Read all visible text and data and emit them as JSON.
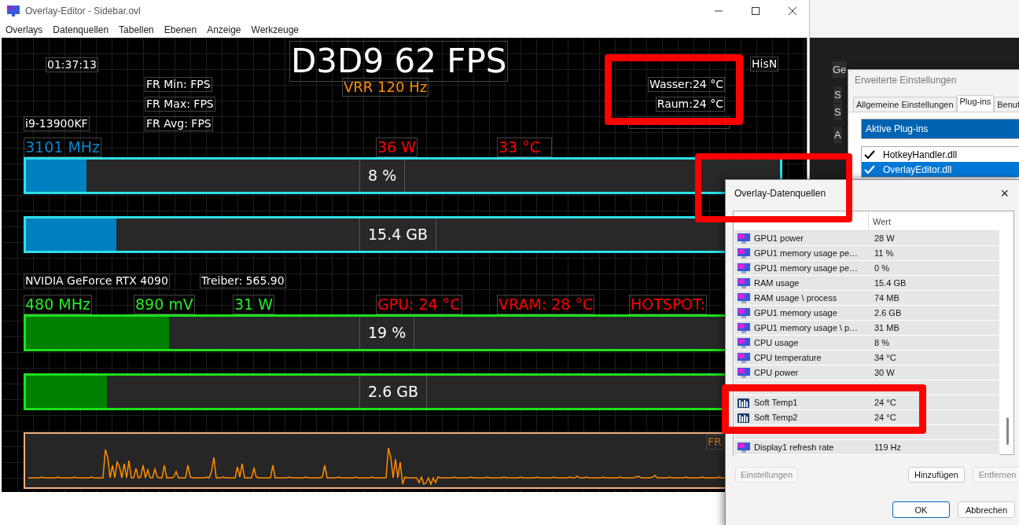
{
  "window": {
    "title": "Overlay-Editor - Sidebar.ovl"
  },
  "menu": [
    "Overlays",
    "Datenquellen",
    "Tabellen",
    "Ebenen",
    "Anzeige",
    "Werkzeuge"
  ],
  "overlay": {
    "clock": "01:37:13",
    "fps": "D3D9 62 FPS",
    "vrr": "VRR 120 Hz",
    "frame_stats": [
      "FR Min:  FPS",
      "FR Max:  FPS",
      "FR Avg:  FPS"
    ],
    "cpu_name": "i9-13900KF",
    "hisn": "HisN",
    "sensors": [
      "Wasser:24 °C",
      "Raum:24 °C"
    ],
    "cpu_readings": [
      {
        "text": "3101 MHz",
        "color": "#0a84c8"
      },
      {
        "text": "36 W",
        "color": "#ff0000"
      },
      {
        "text": "33 °C",
        "color": "#ff0000"
      }
    ],
    "cpu_bars": [
      {
        "level": 0.08,
        "reading": "8 %"
      },
      {
        "level": 0.12,
        "reading": "15.4 GB"
      }
    ],
    "gpu_name": "NVIDIA GeForce RTX 4090",
    "driver": "Treiber: 565.90",
    "gpu_readings": [
      {
        "text": "480 MHz",
        "color": "#22ee22"
      },
      {
        "text": "890 mV",
        "color": "#22ee22"
      },
      {
        "text": "31 W",
        "color": "#22ee22"
      },
      {
        "text": "GPU: 24 °C",
        "color": "#ff0000"
      },
      {
        "text": "VRAM: 28 °C",
        "color": "#ff0000"
      },
      {
        "text": "HOTSPOT:",
        "color": "#ff0000"
      }
    ],
    "gpu_bars": [
      {
        "level": 0.19,
        "reading": "19 %"
      },
      {
        "level": 0.107,
        "reading": "2.6 GB"
      }
    ],
    "graph_label": "FR"
  },
  "back_window": {
    "labels": [
      "Ge",
      "S",
      "S",
      "A"
    ]
  },
  "settings_dialog": {
    "title": "Erweiterte Einstellungen",
    "tabs": [
      {
        "label": "Allgemeine Einstellungen",
        "selected": false
      },
      {
        "label": "Plug-ins",
        "selected": true
      },
      {
        "label": "Benut",
        "selected": false
      }
    ],
    "header": "Aktive Plug-ins",
    "plugins": [
      {
        "name": "HotkeyHandler.dll",
        "checked": true,
        "selected": false
      },
      {
        "name": "OverlayEditor.dll",
        "checked": true,
        "selected": true
      }
    ]
  },
  "sources_dialog": {
    "title": "Overlay-Datenquellen",
    "close": "×",
    "column_2": "Wert",
    "rows": [
      {
        "kind": "monitor",
        "name": "GPU1 power",
        "value": "28 W"
      },
      {
        "kind": "monitor",
        "name": "GPU1 memory usage pe…",
        "value": "11 %"
      },
      {
        "kind": "monitor",
        "name": "GPU1 memory usage pe…",
        "value": "0 %"
      },
      {
        "kind": "monitor",
        "name": "RAM usage",
        "value": "15.4 GB"
      },
      {
        "kind": "monitor",
        "name": "RAM usage \\ process",
        "value": "74 MB"
      },
      {
        "kind": "monitor",
        "name": "GPU1 memory usage",
        "value": "2.6 GB"
      },
      {
        "kind": "monitor",
        "name": "GPU1 memory usage \\ p…",
        "value": "31 MB"
      },
      {
        "kind": "monitor",
        "name": "CPU usage",
        "value": "8 %"
      },
      {
        "kind": "monitor",
        "name": "CPU temperature",
        "value": "34 °C"
      },
      {
        "kind": "monitor",
        "name": "CPU power",
        "value": "30 W"
      },
      {
        "kind": "covered"
      },
      {
        "kind": "meter",
        "name": "Soft Temp1",
        "value": "24 °C"
      },
      {
        "kind": "meter",
        "name": "Soft Temp2",
        "value": "24 °C"
      },
      {
        "kind": "covered"
      },
      {
        "kind": "monitor",
        "name": "Display1 refresh rate",
        "value": "119 Hz"
      }
    ],
    "buttons": [
      {
        "label": "Einstellungen",
        "disabled": true
      },
      {
        "label": "Hinzufügen",
        "disabled": false
      },
      {
        "label": "Entfernen",
        "disabled": true
      }
    ],
    "ok": "OK",
    "cancel": "Abbrechen"
  },
  "highlights": [
    {
      "kind": "frame"
    },
    {
      "kind": "frame"
    },
    {
      "kind": "frame"
    }
  ]
}
